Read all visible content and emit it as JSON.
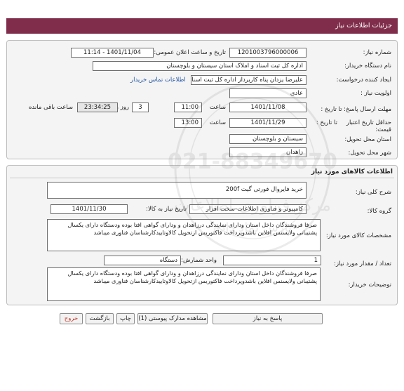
{
  "header": {
    "title": "جزئیات اطلاعات نیاز"
  },
  "need_info": {
    "need_number_label": "شماره نیاز:",
    "need_number": "1201003796000006",
    "announce_label": "تاریخ و ساعت اعلان عمومی:",
    "announce_value": "1401/11/04 - 11:14",
    "buyer_org_label": "نام دستگاه خریدار:",
    "buyer_org": "اداره کل ثبت اسناد و املاک استان سیستان و بلوچستان",
    "requester_label": "ایجاد کننده درخواست:",
    "requester": "علیرضا یزدان پناه کاربرداز اداره کل ثبت اسناد و املاک استان سیستان و بلوچستان",
    "contact_link": "اطلاعات تماس خریدار",
    "priority_label": "اولویت نیاز :",
    "priority": "عادی",
    "deadline_label": "مهلت ارسال پاسخ: تا تاریخ :",
    "deadline_date": "1401/11/08",
    "time_label": "ساعت",
    "deadline_time": "11:00",
    "days_value": "3",
    "days_label": "روز و",
    "remaining_time": "23:34:25",
    "remaining_label": "ساعت باقی مانده",
    "validity_label": "حداقل تاریخ اعتبار قیمت:",
    "validity_prefix": "تا تاریخ :",
    "validity_date": "1401/11/29",
    "validity_time": "13:00",
    "delivery_province_label": "استان محل تحویل:",
    "delivery_province": "سیستان و بلوچستان",
    "delivery_city_label": "شهر محل تحویل:",
    "delivery_city": "زاهدان"
  },
  "goods": {
    "section_title": "اطلاعات کالاهای مورد نیاز",
    "summary_label": "شرح کلی نیاز:",
    "summary": "خرید فایروال فورتی گیت 200f",
    "group_label": "گروه کالا:",
    "group": "کامپیوتر و فناوری اطلاعات-سخت افزار",
    "need_date_label": "تاریخ نیاز به کالا:",
    "need_date": "1401/11/30",
    "specs_label": "مشخصات کالای مورد نیاز:",
    "specs": "صرفا فروشندگان داخل استان ودارای نمایندگی درزاهدان  و ودارای گواهی افتا بوده ودستگاه دارای یکسال پشتیبانی ولایسنس افلاین باشدوپرداخت فاکتوربس ازتحویل کالاوتاییدکارشناسان فناوری میباشد",
    "qty_label": "تعداد / مقدار مورد نیاز:",
    "qty": "1",
    "unit_label": "واحد شمارش:",
    "unit": "دستگاه",
    "buyer_notes_label": "توضیحات خریدار:",
    "buyer_notes": "صرفا فروشندگان داخل استان ودارای نمایندگی درزاهدان  و ودارای گواهی افتا بوده ودستگاه دارای یکسال پشتیبانی ولایسنس افلاین باشدوپرداخت فاکتوربس ازتحویل کالاوتاییدکارشناسان فناوری میباشد"
  },
  "watermark": {
    "line1": "مرکز فراوری اطلاعات",
    "line2": "پارس نماد داده",
    "line3": "021-88349670"
  },
  "buttons": {
    "reply": "پاسخ به نیاز",
    "attachments": "مشاهده مدارک پیوستی (1)",
    "print": "چاپ",
    "back": "بازگشت",
    "exit": "خروج"
  }
}
